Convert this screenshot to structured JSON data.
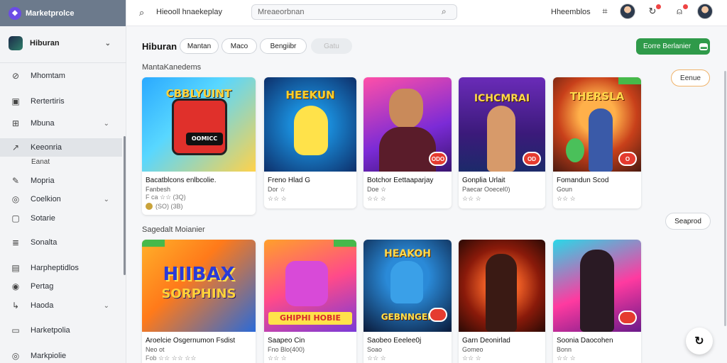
{
  "app": {
    "title": "Marketprolce"
  },
  "sidebar": {
    "workspace": "Hiburan",
    "items": [
      {
        "label": "Mhomtam",
        "icon": "compass-icon"
      },
      {
        "label": "Rertertiris",
        "icon": "clipboard-icon"
      },
      {
        "label": "Mbuna",
        "icon": "grid-icon"
      },
      {
        "label": "Keeonria",
        "icon": "trend-icon"
      },
      {
        "label": "Mopria",
        "icon": "pencil-icon"
      },
      {
        "label": "Coelkion",
        "icon": "circle-icon"
      },
      {
        "label": "Sotarie",
        "icon": "chat-icon"
      },
      {
        "label": "Sonalta",
        "icon": "document-icon"
      },
      {
        "label": "Harpheptidlos",
        "icon": "chart-icon"
      },
      {
        "label": "Pertag",
        "icon": "eye-icon"
      },
      {
        "label": "Haoda",
        "icon": "arrow-icon"
      },
      {
        "label": "Harketpolia",
        "icon": "image-icon"
      },
      {
        "label": "Markpiolie",
        "icon": "target-icon"
      }
    ],
    "active_sub": "Eanat"
  },
  "topbar": {
    "query": "Hieooll hnaekeplay",
    "search_placeholder": "Mreaeorbnan",
    "user_label": "Hheemblos"
  },
  "main": {
    "title": "Hiburan",
    "chips": [
      "Mantan",
      "Maco",
      "Bengiibr",
      "Gatu"
    ],
    "cta_label": "Eorre Berlanier",
    "group1_label": "MantaKanedems",
    "group1_button": "Eenue",
    "group2_label": "Sagedalt Moianier",
    "group2_button": "Seaprod",
    "row1": [
      {
        "title": "Bacatblcons enlbcolie.",
        "sub": "Fanbesh",
        "meta1": "F ca ☆☆ (3Q)",
        "meta2": "(SO) (3B)",
        "art": "CBBLYUINT",
        "art2": "OOMICC",
        "badge": ""
      },
      {
        "title": "Freno Hlad G",
        "sub": "Dor ☆",
        "meta1": "☆☆ ☆",
        "meta2": "",
        "art": "HEEKUN",
        "art2": "",
        "badge": ""
      },
      {
        "title": "Botchor Eettaaparjay",
        "sub": "Doe ☆",
        "meta1": "☆☆ ☆",
        "meta2": "",
        "art": "",
        "art2": "",
        "badge": "ODO"
      },
      {
        "title": "Gonplia Urlait",
        "sub": "Paecar Ooecel0)",
        "meta1": "☆☆ ☆",
        "meta2": "",
        "art": "ICHCMRAI",
        "art2": "",
        "badge": "OD"
      },
      {
        "title": "Fomandun Scod",
        "sub": "Goun",
        "meta1": "☆☆ ☆",
        "meta2": "",
        "art": "THERSLA",
        "art2": "",
        "badge": "O"
      }
    ],
    "row2": [
      {
        "title": "Aroelcie Osgernumon Fsdist",
        "sub": "Neo ot",
        "meta1": "Fob ☆☆ ☆☆ ☆☆",
        "art": "HIIBAX",
        "art2": "SORPHINS",
        "badge": ""
      },
      {
        "title": "Saapeo Cin",
        "sub": "Fno Blo(400)",
        "meta1": "☆☆ ☆",
        "art": "",
        "art2": "GHIPHI HOBIE",
        "badge": ""
      },
      {
        "title": "Saobeo Eeelee0j",
        "sub": "Soao",
        "meta1": "☆☆ ☆",
        "art": "HEAKOH",
        "art2": "GEBNNGER",
        "badge": ""
      },
      {
        "title": "Garn Deonirlad",
        "sub": "Gomeo",
        "meta1": "☆☆ ☆",
        "art": "",
        "art2": "",
        "badge": ""
      },
      {
        "title": "Soonia Daocohen",
        "sub": "Bonn",
        "meta1": "☆☆ ☆",
        "art": "",
        "art2": "",
        "badge": ""
      }
    ]
  },
  "colors": {
    "accent": "#2f9a4a",
    "brand": "#6b4ce6",
    "badge": "#e53b2f"
  }
}
